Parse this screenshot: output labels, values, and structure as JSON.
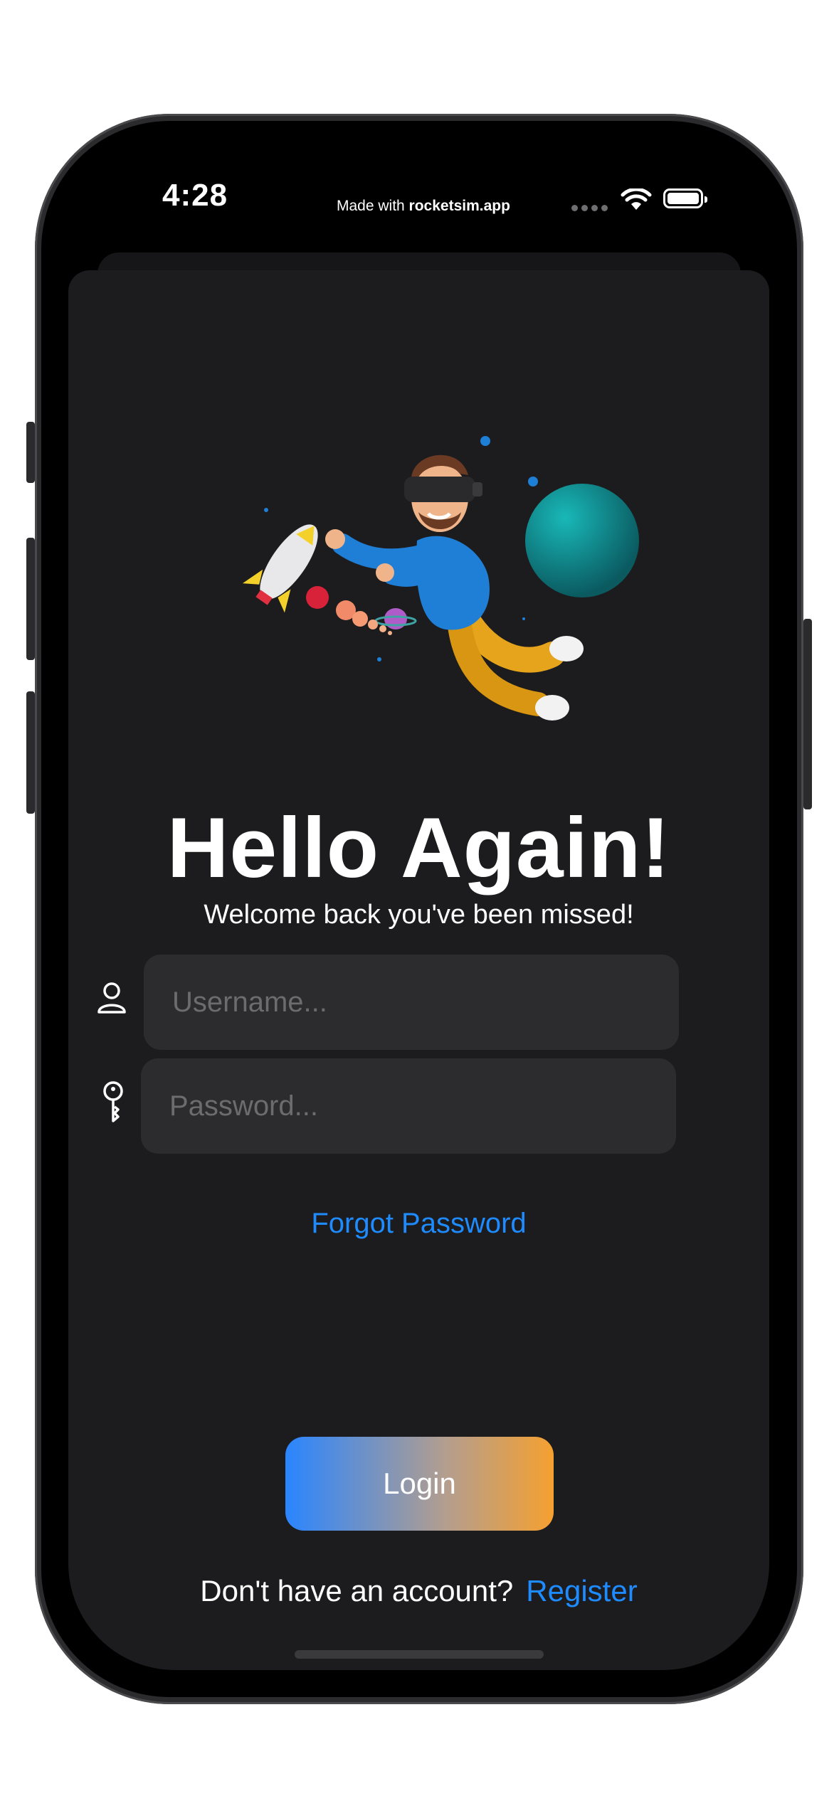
{
  "status_bar": {
    "time": "4:28",
    "made_with_prefix": "Made with ",
    "made_with_brand": "rocketsim.app"
  },
  "login": {
    "title": "Hello Again!",
    "subtitle": "Welcome back you've been missed!",
    "username_placeholder": "Username...",
    "username_value": "",
    "password_placeholder": "Password...",
    "password_value": "",
    "forgot_password": "Forgot Password",
    "login_button": "Login",
    "no_account_text": "Don't have an account?",
    "register_link": "Register"
  },
  "icons": {
    "username": "person-icon",
    "password": "key-icon",
    "wifi": "wifi-icon",
    "battery": "battery-icon"
  },
  "colors": {
    "background": "#1c1c1e",
    "field": "#2c2c2e",
    "link": "#1e8bff",
    "button_gradient_start": "#2a85ff",
    "button_gradient_end": "#f5a030"
  }
}
